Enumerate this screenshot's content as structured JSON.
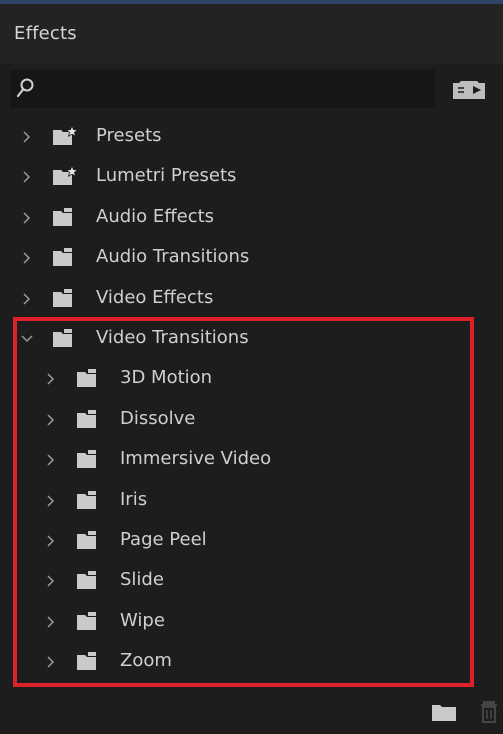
{
  "panel": {
    "title": "Effects"
  },
  "search": {
    "value": "",
    "placeholder": ""
  },
  "icons": {
    "search": "search-icon",
    "presets": "new-preset-bin-icon",
    "folder": "folder-icon",
    "folder_star": "folder-star-icon",
    "chevron_right": "chevron-right-icon",
    "chevron_down": "chevron-down-icon",
    "new_bin": "new-bin-icon",
    "trash": "trash-icon"
  },
  "tree": {
    "items": [
      {
        "label": "Presets",
        "icon": "folder-star-icon",
        "expanded": false,
        "level": 0
      },
      {
        "label": "Lumetri Presets",
        "icon": "folder-star-icon",
        "expanded": false,
        "level": 0
      },
      {
        "label": "Audio Effects",
        "icon": "folder-icon",
        "expanded": false,
        "level": 0
      },
      {
        "label": "Audio Transitions",
        "icon": "folder-icon",
        "expanded": false,
        "level": 0
      },
      {
        "label": "Video Effects",
        "icon": "folder-icon",
        "expanded": false,
        "level": 0
      },
      {
        "label": "Video Transitions",
        "icon": "folder-icon",
        "expanded": true,
        "level": 0
      },
      {
        "label": "3D Motion",
        "icon": "folder-icon",
        "expanded": false,
        "level": 1
      },
      {
        "label": "Dissolve",
        "icon": "folder-icon",
        "expanded": false,
        "level": 1
      },
      {
        "label": "Immersive Video",
        "icon": "folder-icon",
        "expanded": false,
        "level": 1
      },
      {
        "label": "Iris",
        "icon": "folder-icon",
        "expanded": false,
        "level": 1
      },
      {
        "label": "Page Peel",
        "icon": "folder-icon",
        "expanded": false,
        "level": 1
      },
      {
        "label": "Slide",
        "icon": "folder-icon",
        "expanded": false,
        "level": 1
      },
      {
        "label": "Wipe",
        "icon": "folder-icon",
        "expanded": false,
        "level": 1
      },
      {
        "label": "Zoom",
        "icon": "folder-icon",
        "expanded": false,
        "level": 1
      }
    ]
  },
  "colors": {
    "background": "#1d1d1d",
    "tabbar": "#232323",
    "text": "#cfcfcf",
    "highlight": "#e0202a"
  }
}
